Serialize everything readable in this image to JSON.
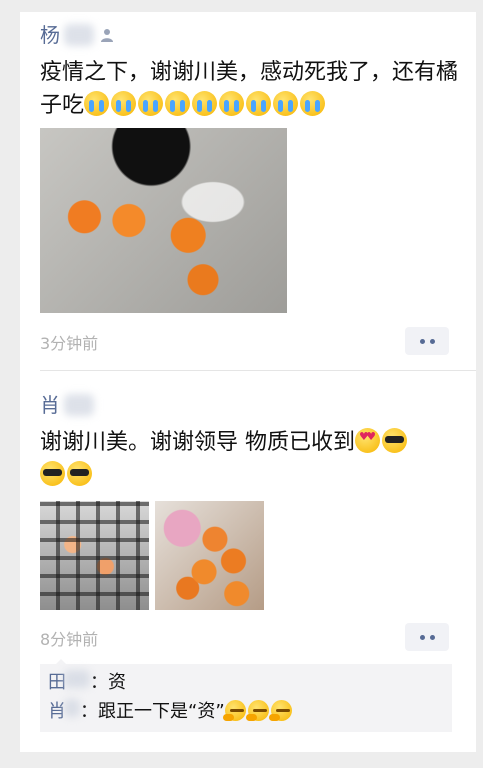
{
  "posts": [
    {
      "author_visible": "杨",
      "text": "疫情之下，谢谢川美，感动死我了，还有橘子吃",
      "emoji_icons": [
        "loudly-crying-face-icon",
        "loudly-crying-face-icon",
        "loudly-crying-face-icon",
        "loudly-crying-face-icon",
        "loudly-crying-face-icon",
        "loudly-crying-face-icon",
        "loudly-crying-face-icon",
        "loudly-crying-face-icon",
        "loudly-crying-face-icon"
      ],
      "time": "3分钟前"
    },
    {
      "author_visible": "肖",
      "text": "谢谢川美。谢谢领导 物质已收到",
      "emoji_icons": [
        "heart-eyes-face-icon",
        "sunglasses-face-icon",
        "sunglasses-face-icon",
        "sunglasses-face-icon"
      ],
      "time": "8分钟前"
    }
  ],
  "comments": [
    {
      "name": "田",
      "sep": "：",
      "text": "资"
    },
    {
      "name": "肖",
      "sep": "：",
      "text": "跟正一下是“资”"
    }
  ],
  "colors": {
    "name_link": "#576b95",
    "time_gray": "#b2b2b2",
    "page_bg": "#ededed"
  }
}
